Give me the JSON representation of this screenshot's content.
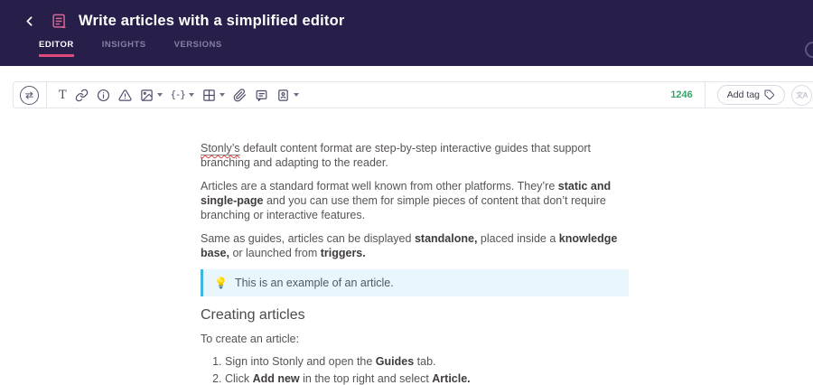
{
  "colors": {
    "header_bg": "#271f4a",
    "accent_pink": "#e0487e",
    "count_green": "#36a56b",
    "callout_bg": "#e9f6fc",
    "callout_border": "#3fb6e0"
  },
  "header": {
    "back_icon": "chevron-left",
    "doc_icon": "article-document",
    "title": "Write articles with a simplified editor",
    "tabs": [
      {
        "label": "EDITOR",
        "active": true
      },
      {
        "label": "INSIGHTS",
        "active": false
      },
      {
        "label": "VERSIONS",
        "active": false
      }
    ]
  },
  "toolbar": {
    "icons": [
      "swap-horizontal",
      "text-style",
      "link",
      "info",
      "warning",
      "image",
      "snippet",
      "table",
      "attachment",
      "note",
      "widget",
      "tag",
      "translate"
    ],
    "text_glyph": "T",
    "snippet_glyph": "{-}",
    "char_count": "1246",
    "add_tag_label": "Add tag",
    "translate_glyph": "文A"
  },
  "content": {
    "paragraphs": [
      {
        "segments": [
          {
            "text": "Stonly’s",
            "style": "misspelled"
          },
          {
            "text": " default content format are step-by-step interactive guides that support branching and adapting to the reader.",
            "style": ""
          }
        ]
      },
      {
        "segments": [
          {
            "text": "Articles are a standard format well known from other platforms. They’re ",
            "style": ""
          },
          {
            "text": "static and single-page",
            "style": "bold"
          },
          {
            "text": " and you can use them for simple pieces of content that don’t require branching or interactive features.",
            "style": ""
          }
        ]
      },
      {
        "segments": [
          {
            "text": "Same as guides, articles can be displayed ",
            "style": ""
          },
          {
            "text": "standalone,",
            "style": "bold"
          },
          {
            "text": " placed inside a ",
            "style": ""
          },
          {
            "text": "knowledge base,",
            "style": "bold"
          },
          {
            "text": " or launched from ",
            "style": ""
          },
          {
            "text": "triggers.",
            "style": "bold"
          }
        ]
      }
    ],
    "callout": {
      "emoji": "💡",
      "text": "This is an example of an article."
    },
    "section_heading": "Creating articles",
    "intro": "To create an article:",
    "steps": [
      {
        "segments": [
          {
            "text": "Sign into Stonly and open the ",
            "style": ""
          },
          {
            "text": "Guides",
            "style": "bold"
          },
          {
            "text": " tab.",
            "style": ""
          }
        ]
      },
      {
        "segments": [
          {
            "text": "Click ",
            "style": ""
          },
          {
            "text": "Add new",
            "style": "bold"
          },
          {
            "text": " in the top right and select ",
            "style": ""
          },
          {
            "text": "Article.",
            "style": "bold"
          }
        ]
      }
    ]
  }
}
